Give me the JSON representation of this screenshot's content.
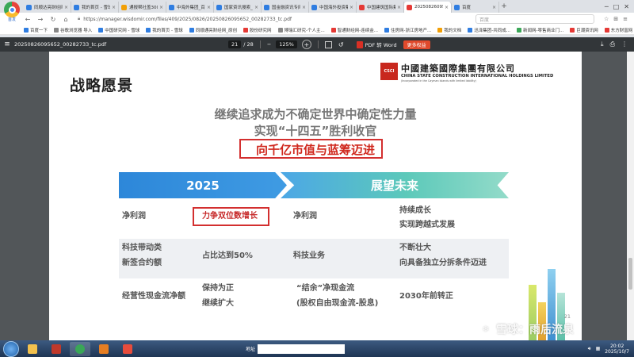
{
  "browser": {
    "logo_caption": "首发",
    "tabs": [
      {
        "label": "同顺达亮财经网 原创",
        "color": "#2f7de1"
      },
      {
        "label": "我的首页 - 雪球",
        "color": "#2f7de1"
      },
      {
        "label": "通报帮社盖300号",
        "color": "#f29f05"
      },
      {
        "label": "中海外集团_百度搜索",
        "color": "#2f7de1"
      },
      {
        "label": "国家资讯搜索_中海",
        "color": "#2f7de1"
      },
      {
        "label": "国金融资讯专网网",
        "color": "#2f7de1"
      },
      {
        "label": "中国海外投资集团",
        "color": "#2f7de1"
      },
      {
        "label": "中国建筑国际集团",
        "color": "#e53935"
      },
      {
        "label": "20250826095652_0...",
        "color": "#e53935",
        "active": true
      },
      {
        "label": "百度",
        "color": "#2f7de1"
      }
    ],
    "new_tab": "+",
    "url": "https://manager.wisdomir.com/files/409/2025/0826/20250826095652_00282733_tc.pdf",
    "search_placeholder": "百度",
    "bookmarks": [
      {
        "label": "百度一下",
        "color": "#2f7de1"
      },
      {
        "label": "谷歌浏览器 导入",
        "color": "#888888"
      },
      {
        "label": "中国研究网 - 雪球",
        "color": "#2f7de1"
      },
      {
        "label": "我的首页 - 雪球",
        "color": "#2f7de1"
      },
      {
        "label": "同顺通亮财经网_原创",
        "color": "#2f7de1"
      },
      {
        "label": "股份研究网",
        "color": "#e53935"
      },
      {
        "label": "博瑞汇研究-个人主...",
        "color": "#888888"
      },
      {
        "label": "智通财经网-连续金...",
        "color": "#e53935"
      },
      {
        "label": "住房网-浙江房地产...",
        "color": "#2f7de1"
      },
      {
        "label": "我的文档",
        "color": "#f29f05"
      },
      {
        "label": "迅泽集团-共同成...",
        "color": "#2f7de1"
      },
      {
        "label": "新闻网-零售商业门...",
        "color": "#3aa757"
      },
      {
        "label": "巨潮资讯网",
        "color": "#e53935"
      },
      {
        "label": "东方财富网",
        "color": "#e53935"
      }
    ]
  },
  "pdf": {
    "filename": "20250826095652_00282733_tc.pdf",
    "current_page": "21",
    "total_pages": "/ 28",
    "zoom": "125%",
    "zoom_out": "−",
    "zoom_in": "+",
    "to_word": "PDF 转 Word",
    "more": "更多权益"
  },
  "slide": {
    "title": "战略愿景",
    "logo_cn": "中國建築國際集團有限公司",
    "logo_en": "CHINA STATE CONSTRUCTION INTERNATIONAL HOLDINGS LIMITED",
    "logo_sub": "(Incorporated in the Cayman Islands with limited liability)",
    "headline_1": "继续追求成为不确定世界中确定性力量",
    "headline_2": "实现“十四五”胜利收官",
    "headline_3": "向千亿市值与蓝筹迈进",
    "band_left": "2025",
    "band_right": "展望未来",
    "rows": [
      {
        "label_2025": "净利润",
        "value_2025": "力争双位数增长",
        "label_future": "净利润",
        "value_future_1": "持续成长",
        "value_future_2": "实现跨越式发展"
      },
      {
        "label_2025_1": "科技带动类",
        "label_2025_2": "新签合约额",
        "value_2025": "占比达到50%",
        "label_future": "科技业务",
        "value_future_1": "不断壮大",
        "value_future_2": "向具备独立分拆条件迈进"
      },
      {
        "label_2025": "经营性现金流净额",
        "value_2025_1": "保持为正",
        "value_2025_2": "继续扩大",
        "label_future_1": "“结余”净现金流",
        "label_future_2": "(股权自由现金流-股息)",
        "value_future": "2030年前转正"
      }
    ],
    "page_number": "21",
    "watermark": "雪球：雨后流泉"
  },
  "taskbar": {
    "address_label": "地址",
    "time": "20:02",
    "date": "2025/10/7"
  }
}
